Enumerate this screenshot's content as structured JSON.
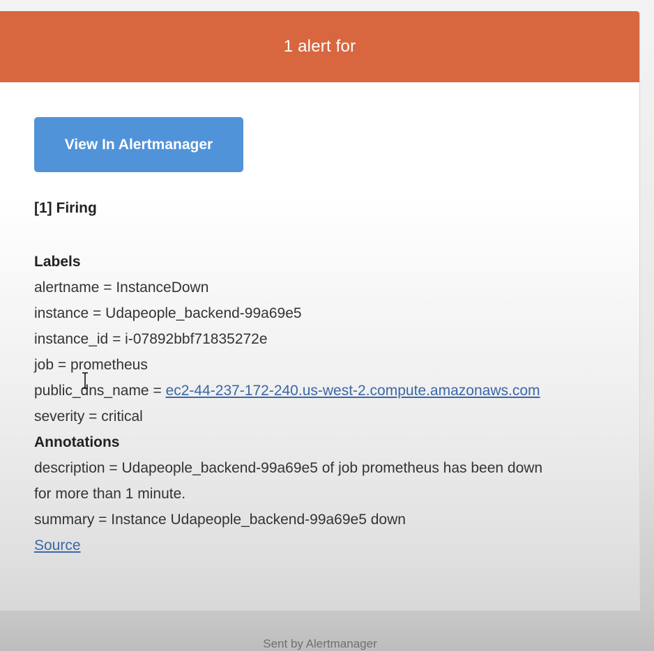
{
  "header": {
    "title": "1 alert for"
  },
  "button": {
    "label": "View In Alertmanager"
  },
  "firing": {
    "title": "[1] Firing"
  },
  "labels": {
    "title": "Labels",
    "alertname": "alertname = InstanceDown",
    "instance": "instance = Udapeople_backend-99a69e5",
    "instance_id": "instance_id = i-07892bbf71835272e",
    "job": "job = prometheus",
    "public_dns_prefix": "public_dns_name = ",
    "public_dns_link": "ec2-44-237-172-240.us-west-2.compute.amazonaws.com",
    "severity": "severity = critical"
  },
  "annotations": {
    "title": "Annotations",
    "description_line1": "description = Udapeople_backend-99a69e5 of job prometheus has been down",
    "description_line2": "for more than 1 minute.",
    "summary": "summary = Instance Udapeople_backend-99a69e5 down"
  },
  "source_link": "Source",
  "footer": {
    "text": "Sent by Alertmanager"
  },
  "colors": {
    "header": "#d8663e",
    "button": "#5193d8",
    "link": "#3b67a6"
  }
}
